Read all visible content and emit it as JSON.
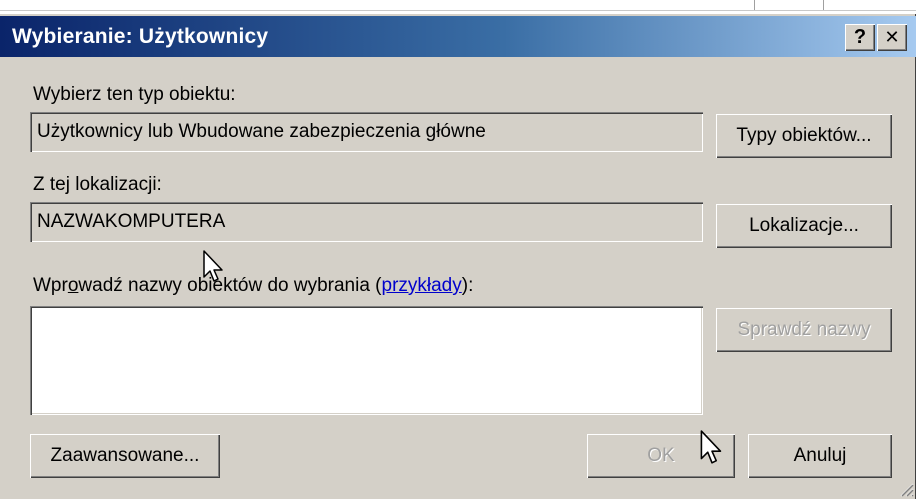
{
  "window": {
    "title": "Wybieranie: Użytkownicy",
    "help_button": "?",
    "close_button": "✕"
  },
  "object_type": {
    "label": "Wybierz ten typ obiektu:",
    "value": "Użytkownicy lub Wbudowane zabezpieczenia główne",
    "button": "Typy obiektów..."
  },
  "location": {
    "label": "Z tej lokalizacji:",
    "value": "NAZWAKOMPUTERA",
    "button": "Lokalizacje..."
  },
  "names": {
    "label_pre": "Wpr",
    "label_ul": "o",
    "label_mid": "wadź nazwy obiektów do wybrania (",
    "link": "przykłady",
    "label_post": "):",
    "value": "",
    "check_button": "Sprawdź nazwy"
  },
  "buttons": {
    "advanced": "Zaawansowane...",
    "ok": "OK",
    "cancel": "Anuluj"
  }
}
